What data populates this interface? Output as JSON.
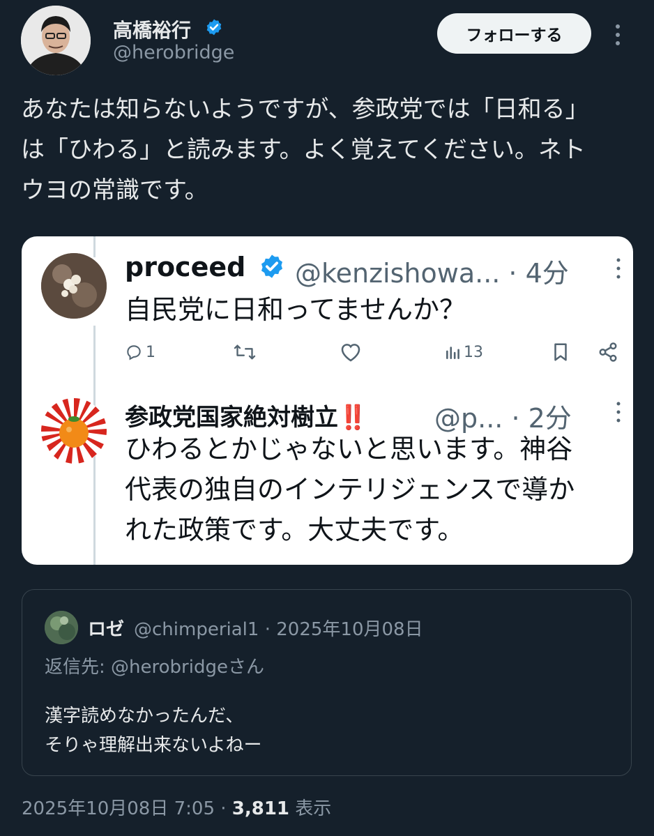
{
  "author": {
    "display_name": "高橋裕行",
    "handle": "@herobridge",
    "follow_label": "フォローする"
  },
  "tweet": {
    "lines": [
      "あなたは知らないようですが、参政党では「日和る」",
      "は「ひわる」と読みます。よく覚えてください。ネト",
      "ウヨの常識です。"
    ],
    "views_count": "3,811",
    "views_label": "表示",
    "timestamp": "2025年10月08日 7:05 · "
  },
  "embedded": {
    "post1": {
      "name": "proceed",
      "handle_time": "@kenzishowa... · 4分",
      "text": "自民党に日和ってませんか？",
      "replies": "1",
      "views": "13"
    },
    "post2": {
      "name": "参政党国家絶対樹立‼️",
      "handle_time": "@p... · 2分",
      "lines": [
        "ひわるとかじゃないと思います。神谷",
        "代表の独自のインテリジェンスで導か",
        "れた政策です。大丈夫です。"
      ]
    }
  },
  "quote": {
    "name": "ロゼ",
    "handle_time": "@chimperial1 · 2025年10月08日",
    "reply_to": "返信先: @herobridgeさん",
    "lines": [
      "漢字読めなかったんだ、",
      "そりゃ理解出来ないよねー"
    ]
  },
  "colors": {
    "background": "#15202b",
    "verified": "#1d9bf0",
    "secondary_text": "#8b98a5"
  },
  "icons": [
    "verified-badge-icon",
    "more-icon",
    "reply-icon",
    "retweet-icon",
    "like-icon",
    "views-icon",
    "bookmark-icon",
    "share-icon"
  ]
}
